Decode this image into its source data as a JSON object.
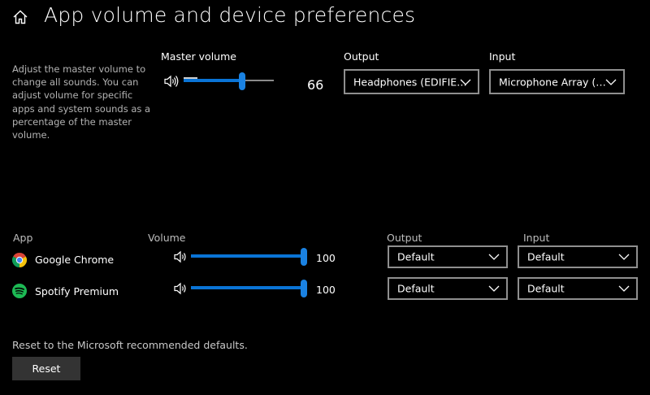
{
  "header": {
    "title": "App volume and device preferences",
    "home_icon": "home-icon"
  },
  "description": "Adjust the master volume to change all sounds. You can adjust volume for specific apps and system sounds as a percentage of the master volume.",
  "master": {
    "label": "Master volume",
    "value": "66",
    "level": 0.66,
    "output_label": "Output",
    "output_selected": "Headphones (EDIFIE…",
    "input_label": "Input",
    "input_selected": "Microphone Array (…"
  },
  "apps_header": {
    "app": "App",
    "volume": "Volume",
    "output": "Output",
    "input": "Input"
  },
  "apps": [
    {
      "name": "Google Chrome",
      "icon": "chrome-icon",
      "volume": "100",
      "level": 1.0,
      "output": "Default",
      "input": "Default"
    },
    {
      "name": "Spotify Premium",
      "icon": "spotify-icon",
      "volume": "100",
      "level": 1.0,
      "output": "Default",
      "input": "Default"
    }
  ],
  "reset": {
    "text": "Reset to the Microsoft recommended defaults.",
    "button_label": "Reset"
  },
  "colors": {
    "accent": "#1a82e2",
    "background": "#000000",
    "spotify": "#1db954"
  }
}
